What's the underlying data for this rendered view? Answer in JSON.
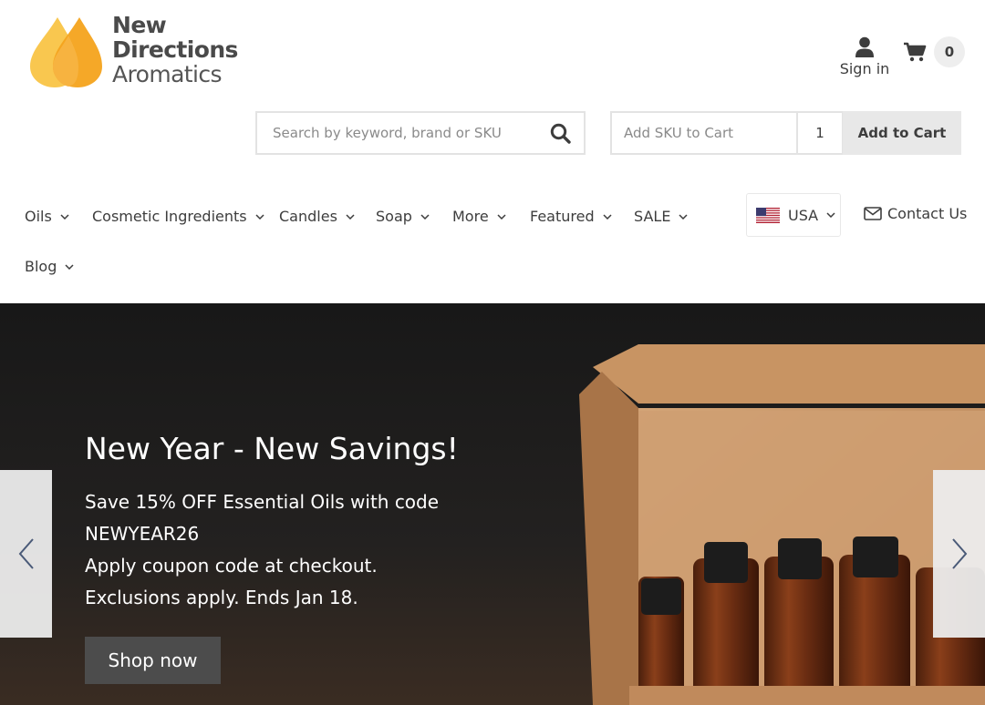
{
  "logo": {
    "line1": "New",
    "line2": "Directions",
    "line3": "Aromatics",
    "colors": {
      "drop_light": "#f9c74f",
      "drop_dark": "#f4a31c"
    }
  },
  "header": {
    "signin_label": "Sign in",
    "cart_count": "0",
    "search_placeholder": "Search by keyword, brand or SKU",
    "sku_placeholder": "Add SKU to Cart",
    "quantity": "1",
    "add_to_cart_label": "Add to Cart"
  },
  "nav": {
    "items": [
      {
        "label": "Oils"
      },
      {
        "label": "Cosmetic Ingredients"
      },
      {
        "label": "Candles"
      },
      {
        "label": "Soap"
      },
      {
        "label": "More"
      },
      {
        "label": "Featured"
      },
      {
        "label": "SALE"
      },
      {
        "label": "Blog"
      }
    ],
    "country_label": "USA",
    "contact_label": "Contact Us"
  },
  "hero": {
    "title": "New Year - New Savings!",
    "lines": [
      "Save 15% OFF Essential Oils with code",
      "NEWYEAR26",
      "Apply coupon code at checkout.",
      "Exclusions apply. Ends Jan 18."
    ],
    "button_label": "Shop now"
  },
  "icons": {
    "user": "user-icon",
    "cart": "cart-icon",
    "search": "search-icon",
    "chevron": "chevron-down-icon",
    "envelope": "envelope-icon",
    "flag": "us-flag-icon",
    "prev": "chevron-left-icon",
    "next": "chevron-right-icon"
  }
}
